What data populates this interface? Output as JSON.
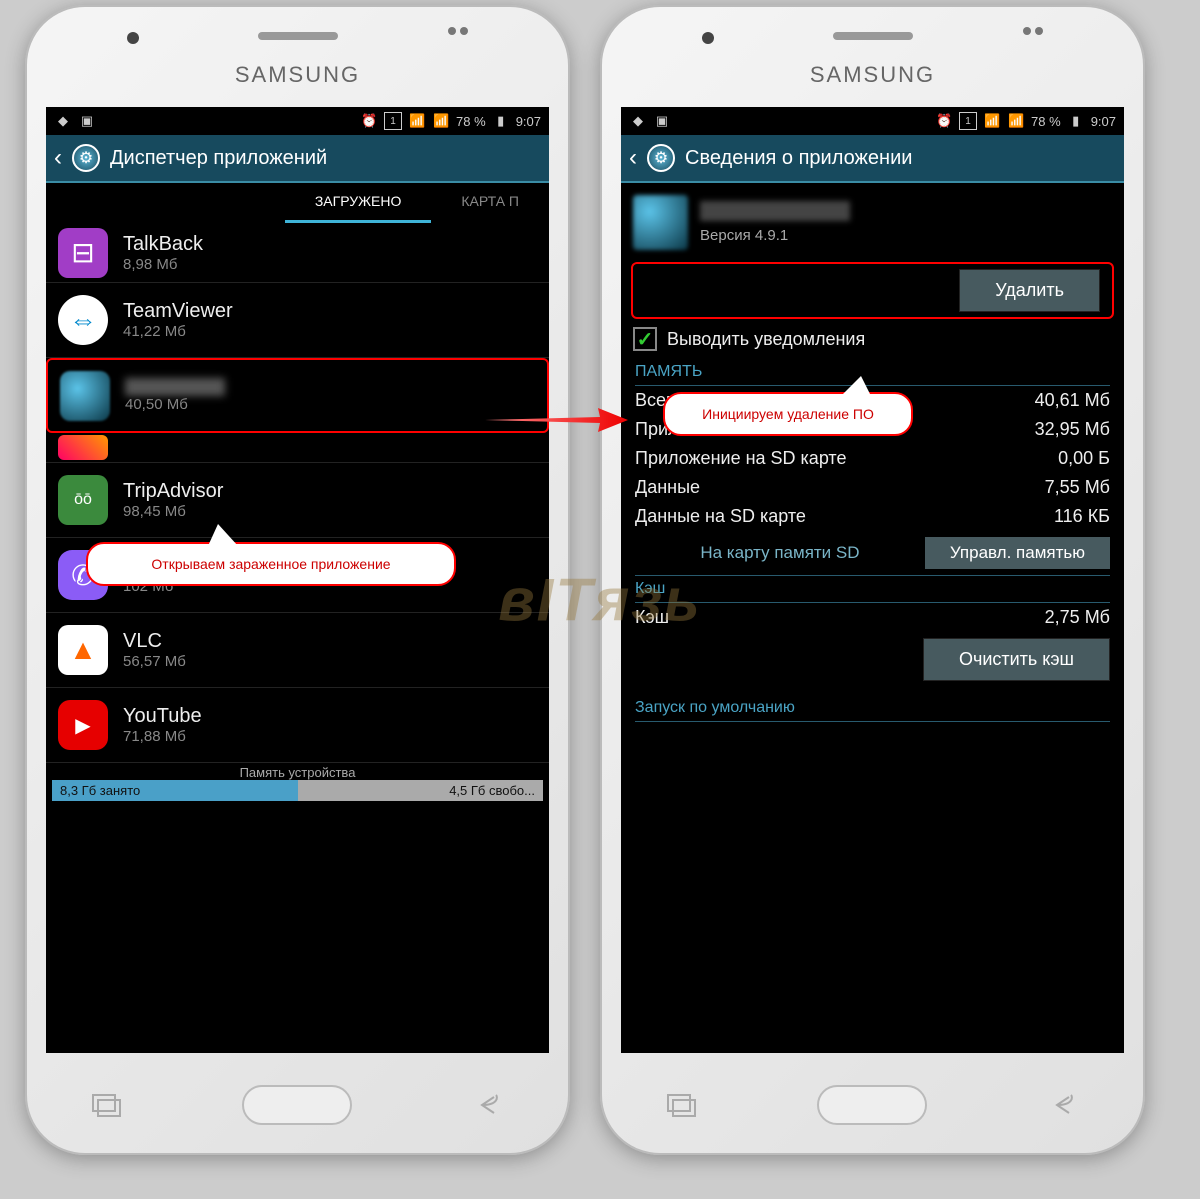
{
  "brand": "SAMSUNG",
  "status": {
    "time": "9:07",
    "battery": "78 %"
  },
  "left": {
    "title": "Диспетчер приложений",
    "tabs": {
      "active": "ЗАГРУЖЕНО",
      "next": "КАРТА П"
    },
    "apps": [
      {
        "name": "TalkBack",
        "size": "8,98 Мб",
        "iconColor": "#a13dc6",
        "glyph": "⊟"
      },
      {
        "name": "TeamViewer",
        "size": "41,22 Мб",
        "iconColor": "#fff",
        "glyph": "↔"
      },
      {
        "name": "",
        "size": "40,50 Мб",
        "iconColor": "blurred",
        "glyph": ""
      },
      {
        "name": "TripAdvisor",
        "size": "98,45 Мб",
        "iconColor": "#3b8a3d",
        "glyph": "ōō"
      },
      {
        "name": "Viber",
        "size": "102 Мб",
        "iconColor": "#8b5cf6",
        "glyph": "✆"
      },
      {
        "name": "VLC",
        "size": "56,57 Мб",
        "iconColor": "#f60",
        "glyph": "▲"
      },
      {
        "name": "YouTube",
        "size": "71,88 Мб",
        "iconColor": "#e60000",
        "glyph": "▶"
      }
    ],
    "memoryTitle": "Память устройства",
    "memoryUsed": "8,3 Гб занято",
    "memoryFree": "4,5 Гб свобо...",
    "callout": "Открываем зараженное приложение"
  },
  "right": {
    "title": "Сведения о приложении",
    "version": "Версия 4.9.1",
    "deleteBtn": "Удалить",
    "notifications": "Выводить уведомления",
    "callout": "Инициируем удаление ПО",
    "storageHead": "ПАМЯТЬ",
    "rows": [
      {
        "label": "Всего",
        "val": "40,61 Мб"
      },
      {
        "label": "Приложение",
        "val": "32,95 Мб"
      },
      {
        "label": "Приложение на SD карте",
        "val": "0,00 Б"
      },
      {
        "label": "Данные",
        "val": "7,55 Мб"
      },
      {
        "label": "Данные на SD карте",
        "val": "116 КБ"
      }
    ],
    "sdLabel": "На карту памяти SD",
    "sdBtn": "Управл. памятью",
    "cacheHead": "Кэш",
    "cacheLabel": "Кэш",
    "cacheVal": "2,75 Мб",
    "clearBtn": "Очистить кэш",
    "launchHead": "Запуск по умолчанию"
  },
  "watermark": "вITязь"
}
